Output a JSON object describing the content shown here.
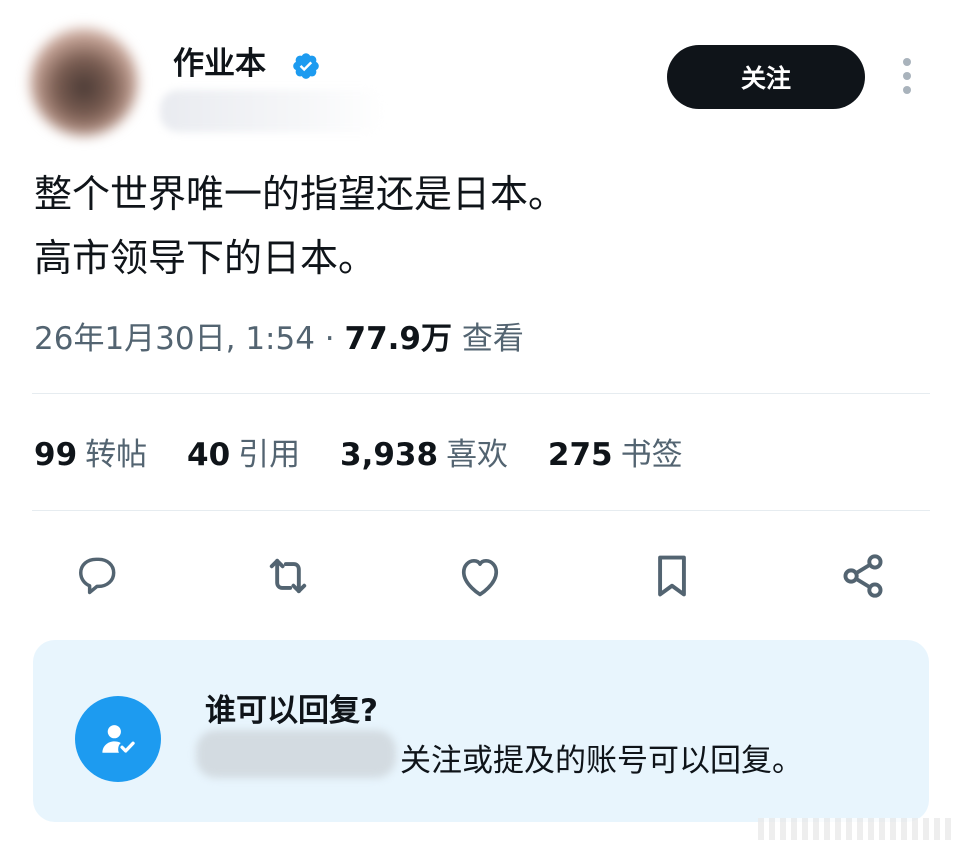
{
  "author": {
    "name": "作业本",
    "follow_label": "关注"
  },
  "tweet": {
    "lines": [
      "整个世界唯一的指望还是日本。",
      "高市领导下的日本。"
    ],
    "timestamp": "26年1月30日, 1:54",
    "separator": " · ",
    "views_count": "77.9万",
    "views_label": "查看"
  },
  "stats": [
    {
      "count": "99",
      "label": "转帖"
    },
    {
      "count": "40",
      "label": "引用"
    },
    {
      "count": "3,938",
      "label": "喜欢"
    },
    {
      "count": "275",
      "label": "书签"
    }
  ],
  "reply_settings": {
    "title": "谁可以回复?",
    "description": "关注或提及的账号可以回复。"
  },
  "colors": {
    "accent": "#1d9bf0",
    "text_primary": "#0f1419",
    "text_secondary": "#536471",
    "reply_box_bg": "#e8f5fd"
  },
  "icons": [
    "verified-badge-icon",
    "more-options-icon",
    "reply-icon",
    "retweet-icon",
    "like-icon",
    "bookmark-icon",
    "share-icon",
    "who-can-reply-icon"
  ]
}
